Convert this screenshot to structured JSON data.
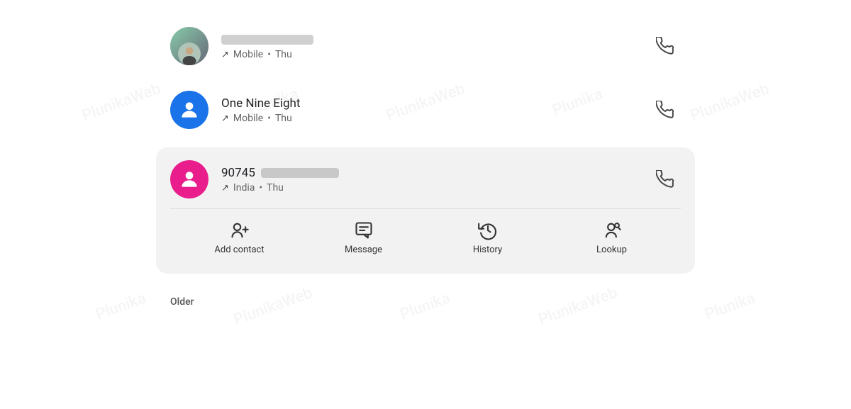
{
  "watermark": {
    "texts": [
      "PlunikaWeb",
      "Plunika",
      "PlunikaWeb",
      "Plunika",
      "PlunikaWeb",
      "Plunika",
      "PlunikaWeb",
      "Plunika"
    ]
  },
  "calls": [
    {
      "id": "call-1",
      "avatar_type": "photo",
      "name": "",
      "name_blurred": true,
      "call_direction": "↗",
      "call_type": "Mobile",
      "call_day": "Thu",
      "has_phone_btn": true
    },
    {
      "id": "call-2",
      "avatar_type": "blue",
      "name": "One Nine Eight",
      "call_direction": "↗",
      "call_type": "Mobile",
      "call_day": "Thu",
      "has_phone_btn": true
    },
    {
      "id": "call-3",
      "avatar_type": "pink",
      "name": "90745",
      "name_blurred": true,
      "call_direction": "↗",
      "call_type": "India",
      "call_day": "Thu",
      "has_phone_btn": true,
      "expanded": true,
      "actions": [
        {
          "id": "add-contact",
          "label": "Add contact"
        },
        {
          "id": "message",
          "label": "Message"
        },
        {
          "id": "history",
          "label": "History"
        },
        {
          "id": "lookup",
          "label": "Lookup"
        }
      ]
    }
  ],
  "older_label": "Older",
  "meta_separator": "•"
}
